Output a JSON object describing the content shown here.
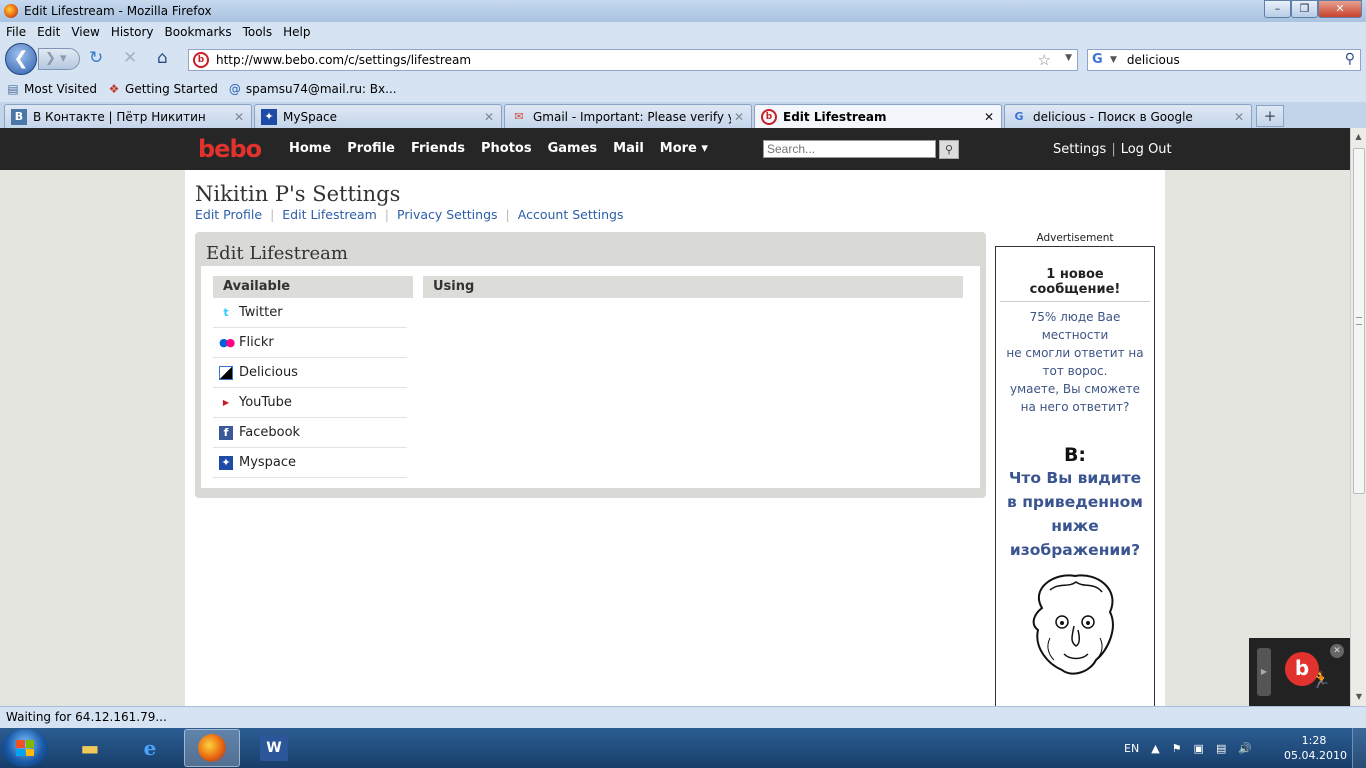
{
  "window": {
    "title": "Edit Lifestream - Mozilla Firefox",
    "minimize": "–",
    "maximize": "❐",
    "close": "✕"
  },
  "menu": [
    "File",
    "Edit",
    "View",
    "History",
    "Bookmarks",
    "Tools",
    "Help"
  ],
  "nav": {
    "url": "http://www.bebo.com/c/settings/lifestream",
    "search_query": "delicious"
  },
  "bookmarks": [
    {
      "label": "Most Visited",
      "icon": "star-folder-icon"
    },
    {
      "label": "Getting Started",
      "icon": "firefox-bookmark-icon"
    },
    {
      "label": "spamsu74@mail.ru: Вх...",
      "icon": "mailru-icon"
    }
  ],
  "tabs": [
    {
      "label": "В Контакте | Пётр Никитин",
      "icon": "vk-icon",
      "active": false
    },
    {
      "label": "MySpace",
      "icon": "myspace-icon",
      "active": false
    },
    {
      "label": "Gmail - Important: Please verify you...",
      "icon": "gmail-icon",
      "active": false
    },
    {
      "label": "Edit Lifestream",
      "icon": "bebo-icon",
      "active": true
    },
    {
      "label": "delicious - Поиск в Google",
      "icon": "google-icon",
      "active": false
    }
  ],
  "bebo": {
    "logo": "bebo",
    "nav": [
      "Home",
      "Profile",
      "Friends",
      "Photos",
      "Games",
      "Mail",
      "More ▾"
    ],
    "search_placeholder": "Search...",
    "settings": "Settings",
    "logout": "Log Out"
  },
  "page": {
    "title": "Nikitin P's Settings",
    "sublinks": [
      "Edit Profile",
      "Edit Lifestream",
      "Privacy Settings",
      "Account Settings"
    ],
    "panel_title": "Edit Lifestream",
    "available_header": "Available",
    "using_header": "Using",
    "services": [
      {
        "label": "Twitter",
        "icon": "twitter-icon",
        "color": "#33ccff"
      },
      {
        "label": "Flickr",
        "icon": "flickr-icon",
        "color": "#ff0084"
      },
      {
        "label": "Delicious",
        "icon": "delicious-icon",
        "color": "#3274d1"
      },
      {
        "label": "YouTube",
        "icon": "youtube-icon",
        "color": "#cc181e"
      },
      {
        "label": "Facebook",
        "icon": "facebook-icon",
        "color": "#3b5998"
      },
      {
        "label": "Myspace",
        "icon": "myspace-icon",
        "color": "#1e4ba6"
      }
    ]
  },
  "ad": {
    "label": "Advertisement",
    "headline": "1 новое сообщение!",
    "text_lines": [
      "75% люде Вае",
      "местности",
      "не смогли ответит на",
      "тот ворос.",
      "умаете, Вы сможете",
      "на него ответит?"
    ],
    "question_label": "В:",
    "question_lines": [
      "Что Вы видите",
      "в приведенном",
      "ниже",
      "изображении?"
    ]
  },
  "status": "Waiting for 64.12.161.79...",
  "taskbar": {
    "lang": "EN",
    "time": "1:28",
    "date": "05.04.2010"
  },
  "colors": {
    "bebo_red": "#e1322e",
    "link_blue": "#2c5ea8",
    "header_dark": "#262626"
  }
}
